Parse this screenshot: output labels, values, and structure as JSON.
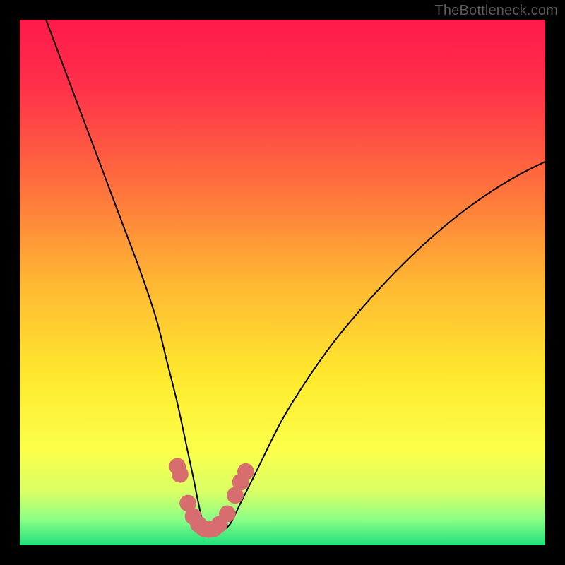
{
  "watermark": "TheBottleneck.com",
  "chart_data": {
    "type": "line",
    "title": "",
    "xlabel": "",
    "ylabel": "",
    "xlim": [
      0,
      100
    ],
    "ylim": [
      0,
      100
    ],
    "gradient": {
      "stops": [
        {
          "pos": 0.0,
          "color": "#ff1a4b"
        },
        {
          "pos": 0.12,
          "color": "#ff2e4a"
        },
        {
          "pos": 0.3,
          "color": "#ff6a3e"
        },
        {
          "pos": 0.5,
          "color": "#ffb733"
        },
        {
          "pos": 0.68,
          "color": "#ffe92e"
        },
        {
          "pos": 0.82,
          "color": "#fcff4a"
        },
        {
          "pos": 0.9,
          "color": "#d8ff66"
        },
        {
          "pos": 0.95,
          "color": "#8cff86"
        },
        {
          "pos": 1.0,
          "color": "#21e07d"
        }
      ]
    },
    "series": [
      {
        "name": "bottleneck-curve",
        "x": [
          5,
          8,
          11,
          14,
          17,
          20,
          23,
          26,
          28,
          30,
          31.5,
          33,
          34,
          35,
          36.5,
          38,
          40,
          42,
          45,
          50,
          55,
          60,
          65,
          70,
          75,
          80,
          85,
          90,
          95,
          100
        ],
        "y": [
          100,
          92,
          84,
          76,
          68,
          60,
          52,
          43,
          35,
          27,
          20,
          13,
          8,
          4,
          2.5,
          2.5,
          4,
          8,
          14,
          24,
          32,
          39,
          45,
          50.5,
          55.5,
          60,
          64,
          67.5,
          70.5,
          73
        ]
      }
    ],
    "markers": {
      "name": "near-minimum-markers",
      "points_xy": [
        [
          30.0,
          15.0
        ],
        [
          30.5,
          13.5
        ],
        [
          32.0,
          8.0
        ],
        [
          33.0,
          5.5
        ],
        [
          34.0,
          4.0
        ],
        [
          35.0,
          3.2
        ],
        [
          36.0,
          3.0
        ],
        [
          37.0,
          3.2
        ],
        [
          38.0,
          4.0
        ],
        [
          39.5,
          6.0
        ],
        [
          41.0,
          9.5
        ],
        [
          42.0,
          12.0
        ],
        [
          43.0,
          14.0
        ]
      ],
      "radius_pct": 1.6,
      "color": "#d76d6e"
    }
  }
}
